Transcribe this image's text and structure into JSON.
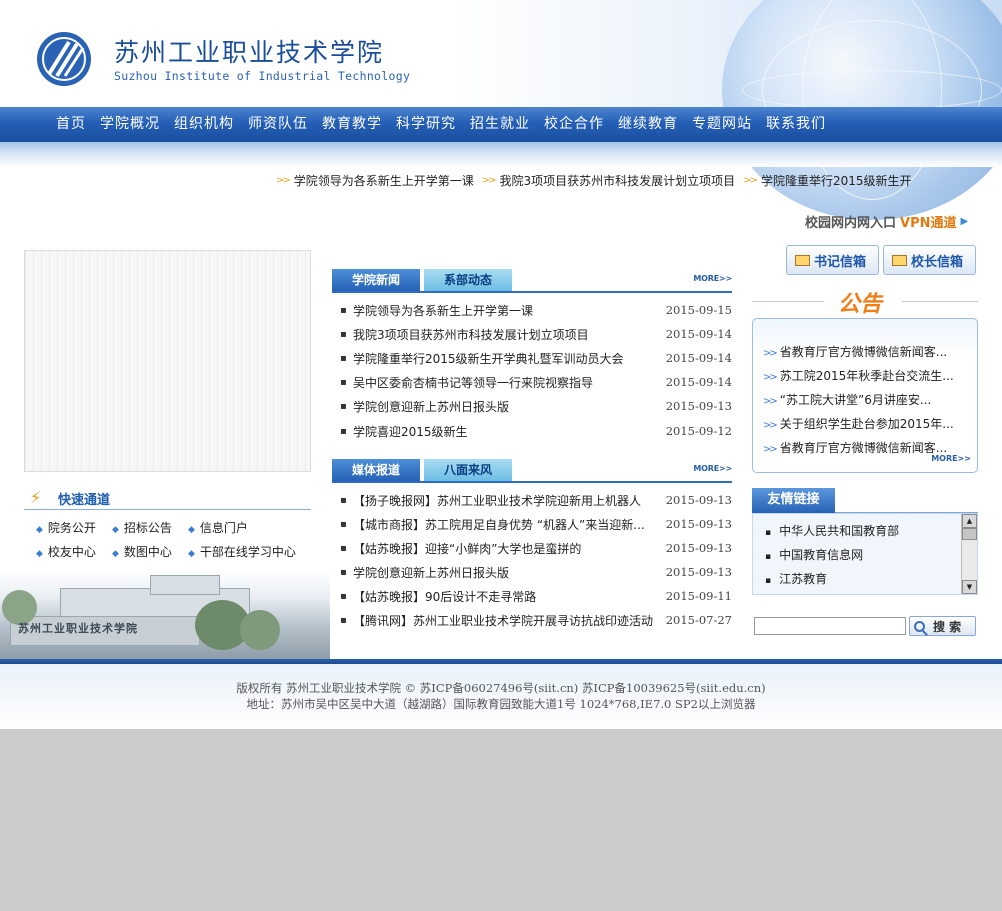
{
  "header": {
    "title": "苏州工业职业技术学院",
    "subtitle": "Suzhou Institute of Industrial Technology"
  },
  "nav": [
    "首页",
    "学院概况",
    "组织机构",
    "师资队伍",
    "教育教学",
    "科学研究",
    "招生就业",
    "校企合作",
    "继续教育",
    "专题网站",
    "联系我们"
  ],
  "ticker": [
    "学院领导为各系新生上开学第一课",
    "我院3项项目获苏州市科技发展计划立项项目",
    "学院隆重举行2015级新生开"
  ],
  "vpn": {
    "label": "校园网内网入口",
    "strong": "VPN通道"
  },
  "quick": {
    "title": "快速通道",
    "items": [
      "院务公开",
      "招标公告",
      "信息门户",
      "校友中心",
      "数图中心",
      "干部在线学习中心"
    ]
  },
  "campus": {
    "sign": "苏州工业职业技术学院"
  },
  "news": {
    "tabs": [
      "学院新闻",
      "系部动态"
    ],
    "more": "MORE>>",
    "items": [
      {
        "title": "学院领导为各系新生上开学第一课",
        "date": "2015-09-15"
      },
      {
        "title": "我院3项项目获苏州市科技发展计划立项项目",
        "date": "2015-09-14"
      },
      {
        "title": "学院隆重举行2015级新生开学典礼暨军训动员大会",
        "date": "2015-09-14"
      },
      {
        "title": "吴中区委俞杏楠书记等领导一行来院视察指导",
        "date": "2015-09-14"
      },
      {
        "title": "学院创意迎新上苏州日报头版",
        "date": "2015-09-13"
      },
      {
        "title": "学院喜迎2015级新生",
        "date": "2015-09-12"
      }
    ]
  },
  "media": {
    "tabs": [
      "媒体报道",
      "八面来风"
    ],
    "more": "MORE>>",
    "items": [
      {
        "title": "【扬子晚报网】苏州工业职业技术学院迎新用上机器人",
        "date": "2015-09-13"
      },
      {
        "title": "【城市商报】苏工院用足自身优势 “机器人”来当迎新...",
        "date": "2015-09-13"
      },
      {
        "title": "【姑苏晚报】迎接“小鲜肉”大学也是蛮拼的",
        "date": "2015-09-13"
      },
      {
        "title": "学院创意迎新上苏州日报头版",
        "date": "2015-09-13"
      },
      {
        "title": "【姑苏晚报】90后设计不走寻常路",
        "date": "2015-09-11"
      },
      {
        "title": "【腾讯网】苏州工业职业技术学院开展寻访抗战印迹活动",
        "date": "2015-07-27"
      }
    ]
  },
  "mail": {
    "secretary": "书记信箱",
    "president": "校长信箱"
  },
  "notice": {
    "title": "公告",
    "more": "MORE>>",
    "items": [
      "省教育厅官方微博微信新闻客...",
      "苏工院2015年秋季赴台交流生...",
      "“苏工院大讲堂”6月讲座安...",
      "关于组织学生赴台参加2015年...",
      "省教育厅官方微博微信新闻客..."
    ]
  },
  "links": {
    "title": "友情链接",
    "items": [
      "中华人民共和国教育部",
      "中国教育信息网",
      "江苏教育"
    ]
  },
  "search": {
    "value": "",
    "button": "搜 索"
  },
  "footer": {
    "line1": "版权所有 苏州工业职业技术学院 © 苏ICP备06027496号(siit.cn) 苏ICP备10039625号(siit.edu.cn)",
    "line2": "地址：苏州市吴中区吴中大道（越湖路）国际教育园致能大道1号 1024*768,IE7.0 SP2以上浏览器"
  },
  "colors": {
    "brand_blue": "#245fb6",
    "accent_orange": "#ef7f1a",
    "background": "#cccccc"
  }
}
